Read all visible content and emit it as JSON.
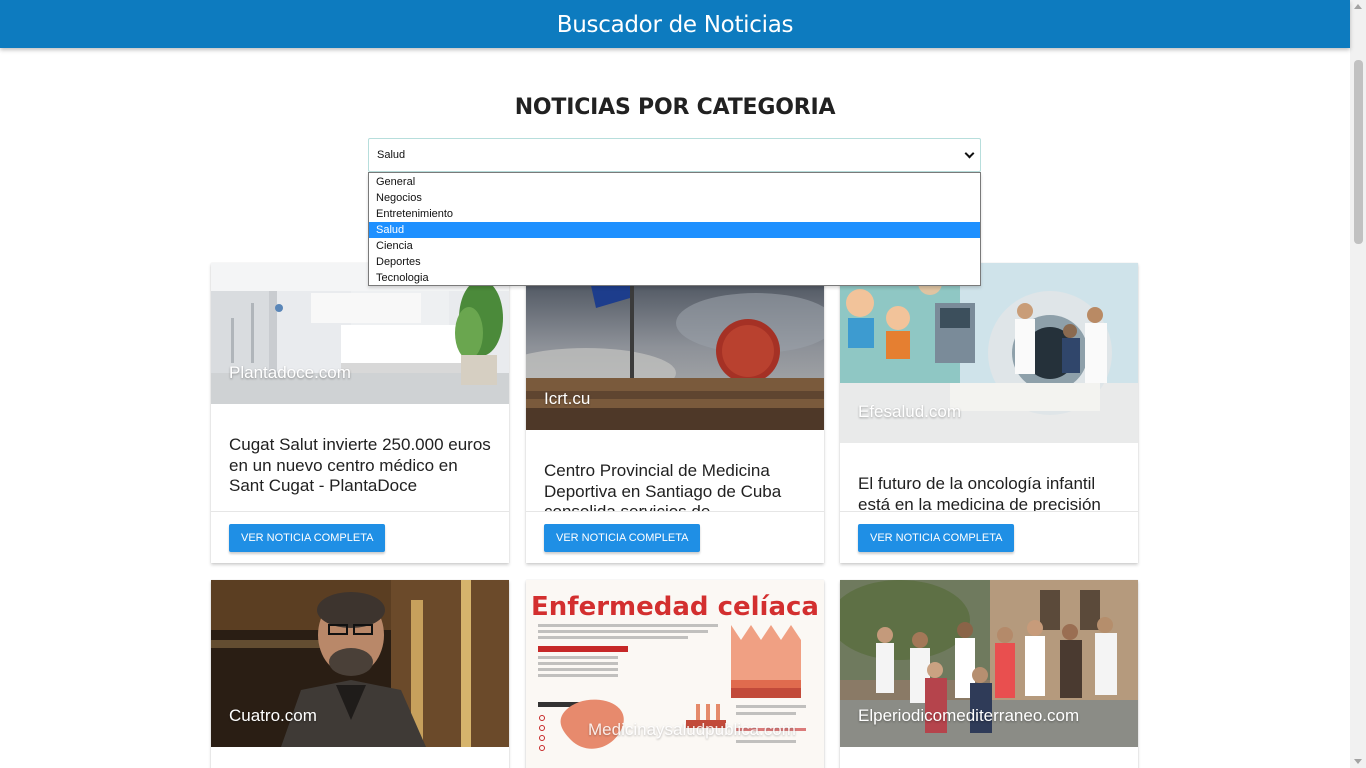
{
  "app": {
    "title": "Buscador de Noticias"
  },
  "heading": "NOTICIAS POR CATEGORIA",
  "category_select": {
    "value": "Salud",
    "options": [
      "General",
      "Negocios",
      "Entretenimiento",
      "Salud",
      "Ciencia",
      "Deportes",
      "Tecnologia"
    ],
    "selected_index": 3
  },
  "button_label": "VER NOTICIA COMPLETA",
  "cards": [
    {
      "source": "Plantadoce.com",
      "title": "Cugat Salut invierte 250.000 euros en un nuevo centro médico en Sant Cugat - PlantaDoce"
    },
    {
      "source": "Icrt.cu",
      "title": "Centro Provincial de Medicina Deportiva en Santiago de Cuba consolida servicios de"
    },
    {
      "source": "Efesalud.com",
      "title": "El futuro de la oncología infantil está en la medicina de precisión"
    },
    {
      "source": "Cuatro.com",
      "title": ""
    },
    {
      "source": "Medicinaysaludpublica.com",
      "title": "",
      "image_text": "Enfermedad celíaca"
    },
    {
      "source": "Elperiodicomediterraneo.com",
      "title": ""
    }
  ],
  "colors": {
    "navbar": "#0d7bbf",
    "button": "#1f8fe5",
    "option_highlight": "#1e90ff",
    "celiac_title": "#d32f2f"
  }
}
